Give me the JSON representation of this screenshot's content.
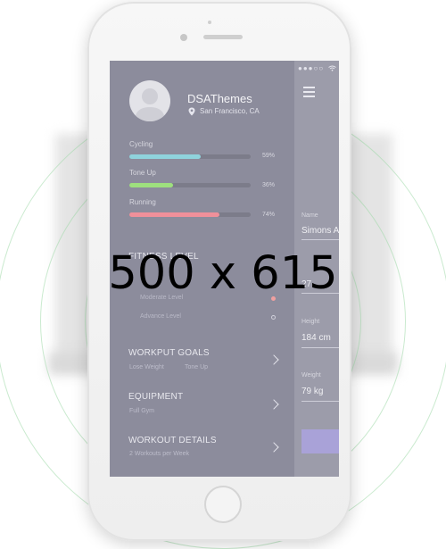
{
  "watermark": {
    "text": "500 x 615"
  },
  "colors": {
    "cycling": "#8fd3dc",
    "tone_up": "#9ee07e",
    "running": "#f0909a",
    "button": "#a9a2d8"
  },
  "status_bar": {
    "signal": "●●●○○",
    "icon": "wifi-icon"
  },
  "menu_button": {
    "icon": "hamburger-icon"
  },
  "profile": {
    "avatar_icon": "user-icon",
    "name": "DSAThemes",
    "location_icon": "location-pin-icon",
    "location": "San Francisco, CA"
  },
  "stats": [
    {
      "label": "Cycling",
      "value": 59,
      "percent": "59%"
    },
    {
      "label": "Tone Up",
      "value": 36,
      "percent": "36%"
    },
    {
      "label": "Running",
      "value": 74,
      "percent": "74%"
    }
  ],
  "fitness_level": {
    "title": "FITNESS LEVEL",
    "items": [
      {
        "label": "Moderate Level"
      },
      {
        "label": "Advance Level"
      }
    ]
  },
  "menu": {
    "goals": {
      "title": "WORKPUT GOALS",
      "sub_1": "Lose Weight",
      "sub_2": "Tone Up"
    },
    "equipment": {
      "title": "EQUIPMENT",
      "sub": "Full Gym"
    },
    "details": {
      "title": "WORKOUT DETAILS",
      "sub": "2 Workouts per Week"
    }
  },
  "form": {
    "name_label": "Name",
    "name_value": "Simons A",
    "age_value": "27",
    "height_label": "Height",
    "height_value": "184 cm",
    "weight_label": "Weight",
    "weight_value": "79 kg"
  }
}
